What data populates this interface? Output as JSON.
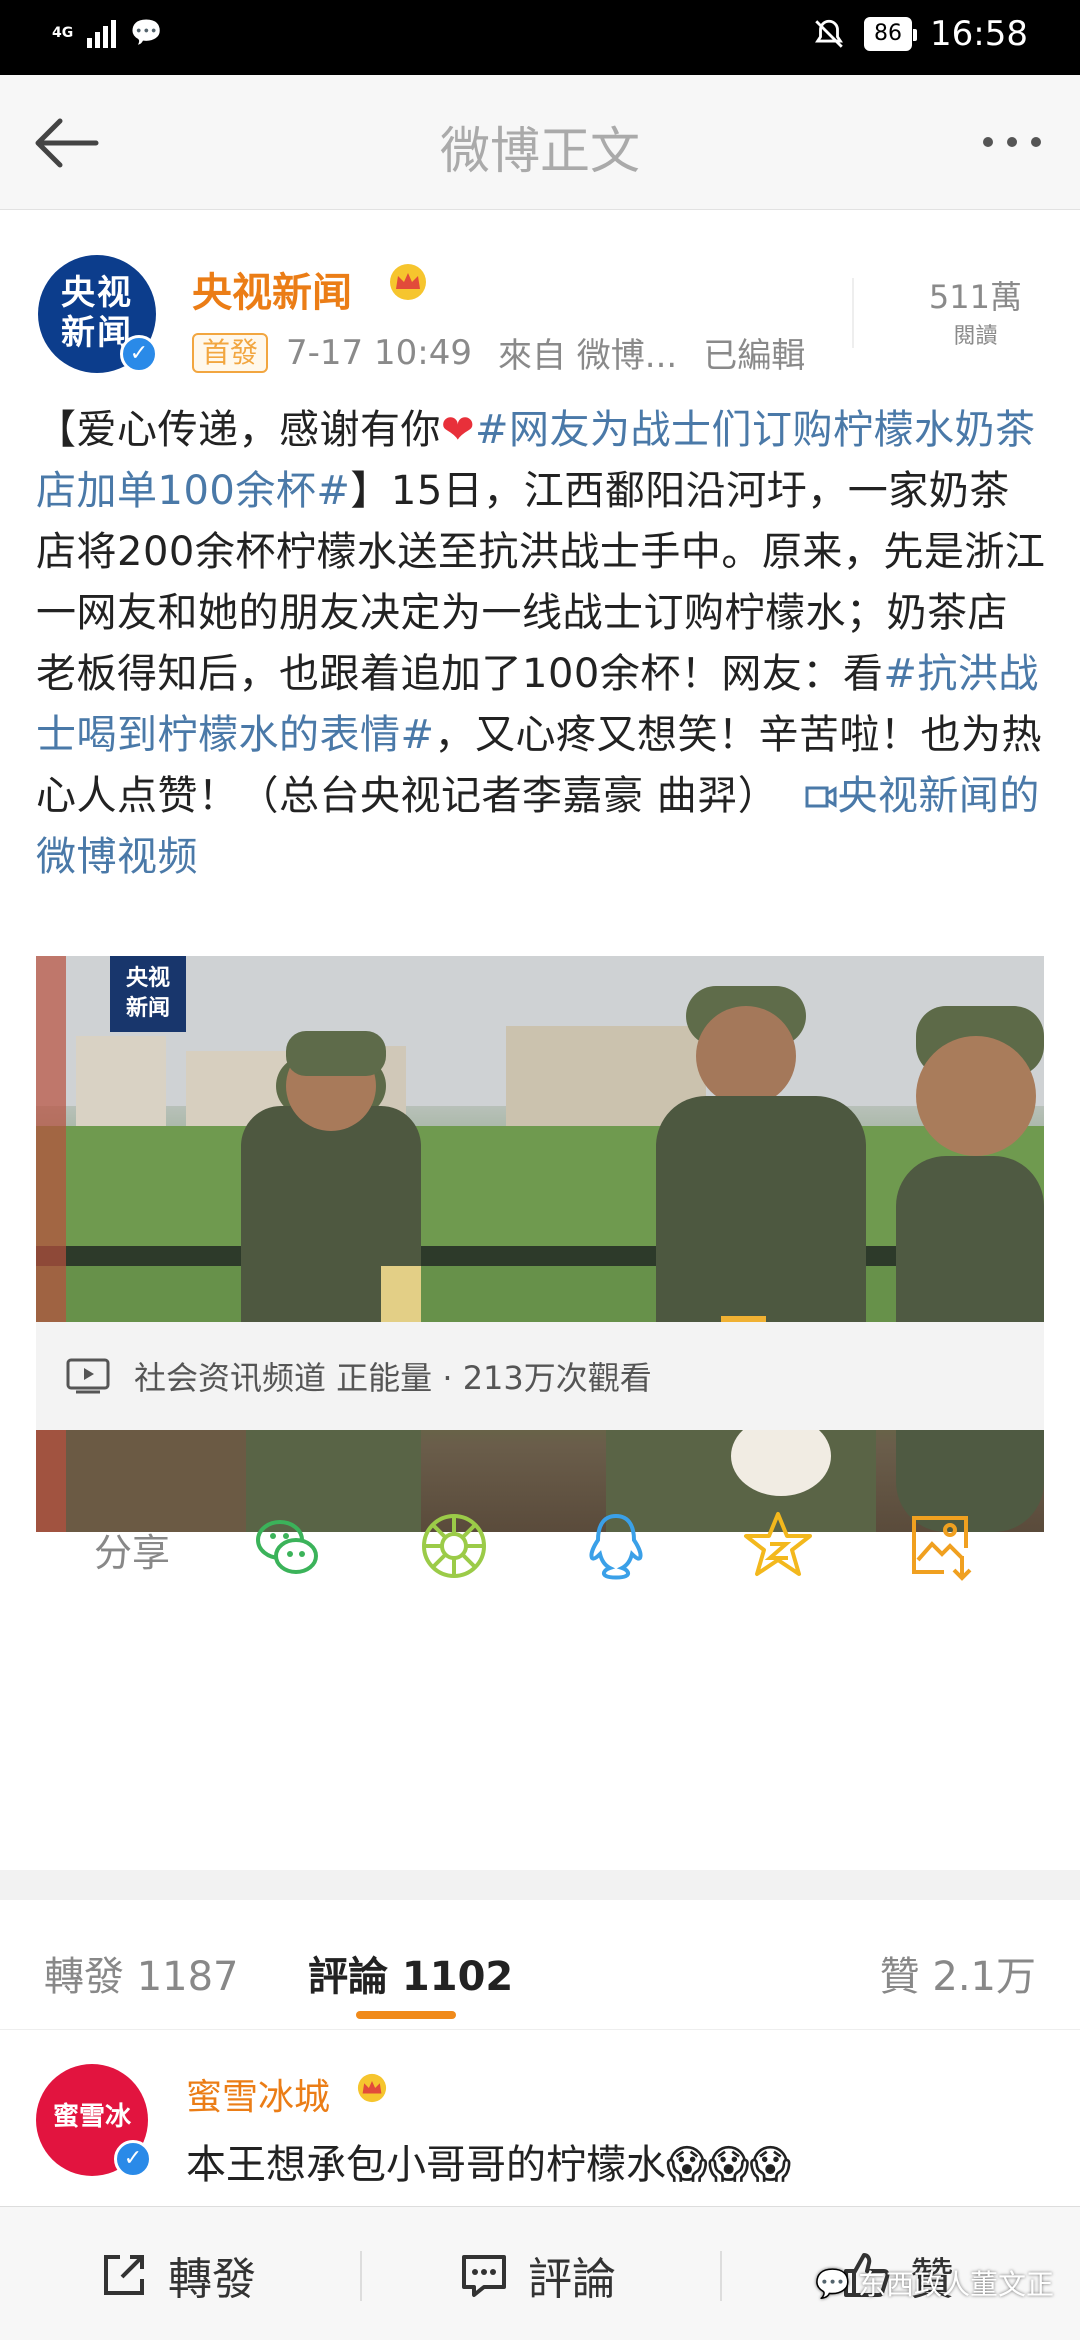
{
  "status_bar": {
    "network": "4G",
    "battery": "86",
    "time": "16:58"
  },
  "nav": {
    "title": "微博正文"
  },
  "post": {
    "author": "央视新闻",
    "avatar_text": "央视新闻",
    "first_badge": "首發",
    "timestamp": "7-17 10:49",
    "source": "來自 微博...",
    "edited": "已編輯",
    "read_count": "511萬",
    "read_label": "閱讀",
    "text_parts": {
      "p1": "【爱心传递，感谢有你",
      "heart": "❤",
      "tag1": "#网友为战士们订购柠檬水奶茶店加单100余杯#",
      "p2": "】15日，江西鄱阳沿河圩，一家奶茶店将200余杯柠檬水送至抗洪战士手中。原来，先是浙江一网友和她的朋友决定为一线战士订购柠檬水；奶茶店老板得知后，也跟着追加了100余杯！网友：看",
      "tag2": "#抗洪战士喝到柠檬水的表情#",
      "p3": "，又心疼又想笑！辛苦啦！也为热心人点赞！（总台央视记者李嘉豪 曲羿）",
      "video_link": "央视新闻的微博视频"
    },
    "video_logo": "央视新闻",
    "video_info": "社会资讯频道 正能量 · 213万次觀看",
    "share_label": "分享"
  },
  "share_icons": [
    "wechat-icon",
    "moments-icon",
    "qq-icon",
    "qzone-icon",
    "save-image-icon"
  ],
  "tabs": {
    "reposts": "轉發 1187",
    "comments": "評論 1102",
    "likes": "贊 2.1万"
  },
  "comment": {
    "avatar_text": "蜜雪冰",
    "name": "蜜雪冰城",
    "text": "本王想承包小哥哥的柠檬水😱😱😱"
  },
  "bottom_bar": {
    "repost": "轉發",
    "comment": "評論",
    "like": "贊",
    "watermark": "东西政人董文正"
  },
  "colors": {
    "accent": "#eb7d16",
    "link": "#4a79a8",
    "verified": "#2a8ae8",
    "wechat": "#3bb35a"
  }
}
